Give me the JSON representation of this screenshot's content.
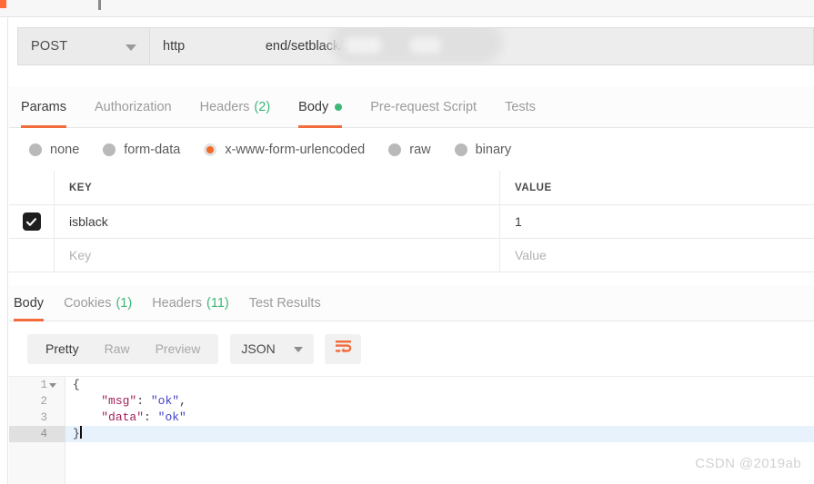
{
  "window": {
    "app": "postman-request-builder"
  },
  "request": {
    "method": "POST",
    "url_prefix": "http",
    "url_suffix": "end/setblack/14",
    "url_redacted": true,
    "tabs": [
      {
        "label": "Params",
        "count": "",
        "active": false
      },
      {
        "label": "Authorization",
        "count": "",
        "active": false
      },
      {
        "label": "Headers",
        "count": "(2)",
        "active": false
      },
      {
        "label": "Body",
        "count": "",
        "active": true,
        "dot": true
      },
      {
        "label": "Pre-request Script",
        "count": "",
        "active": false
      },
      {
        "label": "Tests",
        "count": "",
        "active": false
      }
    ],
    "body_types": [
      {
        "label": "none",
        "selected": false
      },
      {
        "label": "form-data",
        "selected": false
      },
      {
        "label": "x-www-form-urlencoded",
        "selected": true
      },
      {
        "label": "raw",
        "selected": false
      },
      {
        "label": "binary",
        "selected": false
      }
    ],
    "table": {
      "headers": {
        "key": "KEY",
        "value": "VALUE"
      },
      "rows": [
        {
          "checked": true,
          "key": "isblack",
          "value": "1",
          "placeholder": false
        },
        {
          "checked": false,
          "key": "Key",
          "value": "Value",
          "placeholder": true
        }
      ]
    }
  },
  "response": {
    "tabs": [
      {
        "label": "Body",
        "count": "",
        "active": true
      },
      {
        "label": "Cookies",
        "count": "(1)",
        "active": false
      },
      {
        "label": "Headers",
        "count": "(11)",
        "active": false
      },
      {
        "label": "Test Results",
        "count": "",
        "active": false
      }
    ],
    "view_modes": [
      {
        "label": "Pretty",
        "active": true
      },
      {
        "label": "Raw",
        "active": false
      },
      {
        "label": "Preview",
        "active": false
      }
    ],
    "format": "JSON",
    "wrap_icon": "word-wrap-icon",
    "code_lines": [
      {
        "num": "1",
        "fold": true,
        "selected": false,
        "indent": "",
        "text": "{",
        "kind": "punct"
      },
      {
        "num": "2",
        "fold": false,
        "selected": false,
        "indent": "    ",
        "key": "\"msg\"",
        "sep": ": ",
        "val": "\"ok\"",
        "tail": ",",
        "kind": "pair"
      },
      {
        "num": "3",
        "fold": false,
        "selected": false,
        "indent": "    ",
        "key": "\"data\"",
        "sep": ": ",
        "val": "\"ok\"",
        "tail": "",
        "kind": "pair"
      },
      {
        "num": "4",
        "fold": false,
        "selected": true,
        "indent": "",
        "text": "}",
        "kind": "punct"
      }
    ]
  },
  "watermark": "CSDN @2019ab",
  "colors": {
    "accent_orange": "#f26b3a",
    "dot_green": "#3cb878",
    "radio_orange": "#f26b24",
    "json_key": "#a01f5b",
    "json_value": "#4040c8",
    "selection_blue": "#e8f2fd"
  }
}
